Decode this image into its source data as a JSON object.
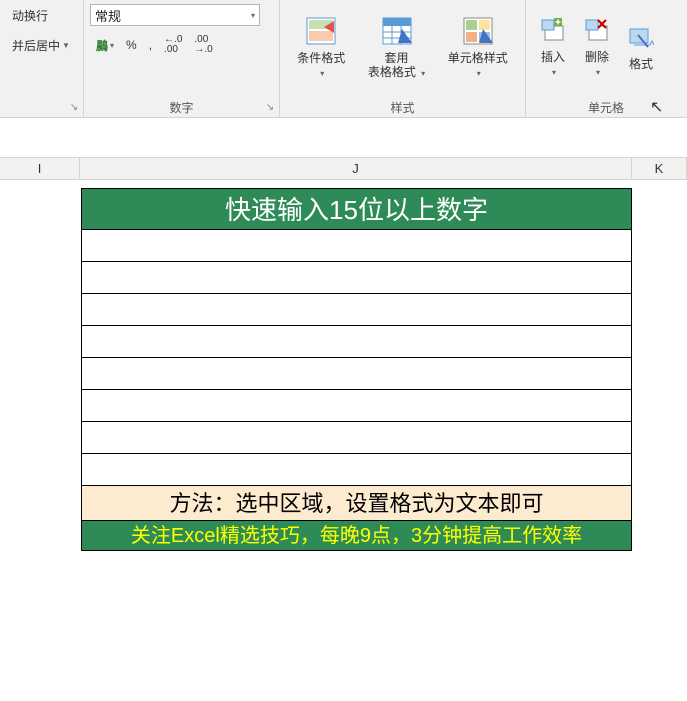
{
  "ribbon": {
    "alignment": {
      "wrap_label": "动换行",
      "merge_label": "并后居中",
      "group_name": ""
    },
    "number": {
      "combo_value": "常规",
      "currency_label": "",
      "percent_label": "%",
      "comma_label": ",",
      "inc_dec_label": ".0 .00",
      "dec_inc_label": ".00 .0",
      "group_name": "数字"
    },
    "styles": {
      "cond_format": "条件格式",
      "table_format_l1": "套用",
      "table_format_l2": "表格格式",
      "cell_style": "单元格样式",
      "group_name": "样式"
    },
    "cells": {
      "insert_label": "插入",
      "delete_label": "删除",
      "format_label": "格式",
      "group_name": "单元格"
    }
  },
  "columns": {
    "i": "I",
    "j": "J",
    "k": "K"
  },
  "table": {
    "title": "快速输入15位以上数字",
    "rows_count": 8,
    "method": "方法：选中区域，设置格式为文本即可",
    "footer": "关注Excel精选技巧，每晚9点，3分钟提高工作效率"
  }
}
